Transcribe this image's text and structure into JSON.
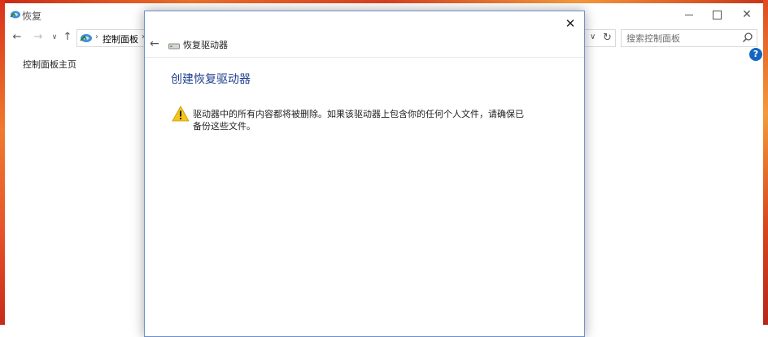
{
  "background_window": {
    "title": "恢复",
    "breadcrumb": "控制面板",
    "search_placeholder": "搜索控制面板",
    "left_link": "控制面板主页",
    "help_label": "?"
  },
  "dialog": {
    "header_title": "恢复驱动器",
    "heading": "创建恢复驱动器",
    "warning": "驱动器中的所有内容都将被删除。如果该驱动器上包含你的任何个人文件，请确保已备份这些文件。"
  },
  "colors": {
    "heading": "#1f3f8c",
    "dialog_border": "#6f91c6",
    "help_badge": "#1565c0",
    "warning_yellow": "#f5c518"
  }
}
